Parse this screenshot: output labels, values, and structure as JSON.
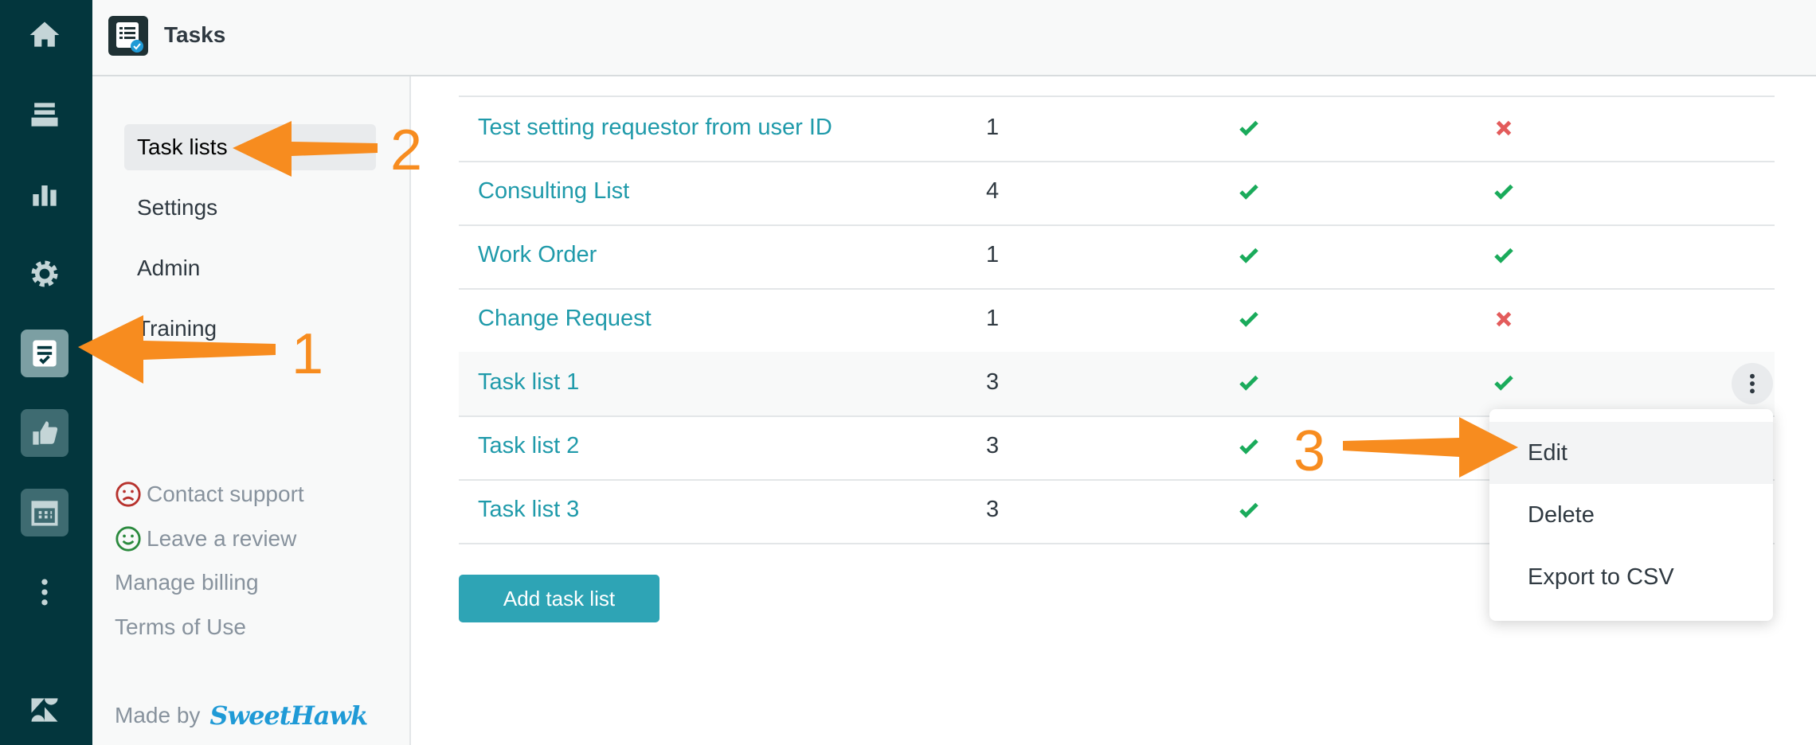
{
  "app": {
    "title": "Tasks",
    "icon": "tasks-app-icon"
  },
  "rail": {
    "icons": [
      "home-icon",
      "views-icon",
      "reporting-icon",
      "admin-gear-icon",
      "tasks-icon",
      "thumbs-up-icon",
      "calendar-icon",
      "more-vertical-icon",
      "zendesk-logo-icon"
    ]
  },
  "leftnav": {
    "items": [
      {
        "label": "Task lists",
        "active": true
      },
      {
        "label": "Settings",
        "active": false
      },
      {
        "label": "Admin",
        "active": false
      },
      {
        "label": "Training",
        "active": false
      }
    ],
    "links": [
      {
        "label": "Contact support",
        "icon": "sad-face-icon"
      },
      {
        "label": "Leave a review",
        "icon": "smiley-face-icon"
      },
      {
        "label": "Manage billing"
      },
      {
        "label": "Terms of Use"
      }
    ],
    "made_by": "Made by",
    "brand": "SweetHawk"
  },
  "table": {
    "rows": [
      {
        "name": "Test setting requestor from user ID",
        "count": "1",
        "col3": "check",
        "col4": "cross"
      },
      {
        "name": "Consulting List",
        "count": "4",
        "col3": "check",
        "col4": "check"
      },
      {
        "name": "Work Order",
        "count": "1",
        "col3": "check",
        "col4": "check"
      },
      {
        "name": "Change Request",
        "count": "1",
        "col3": "check",
        "col4": "cross"
      },
      {
        "name": "Task list 1",
        "count": "3",
        "col3": "check",
        "col4": "check"
      },
      {
        "name": "Task list 2",
        "count": "3",
        "col3": "check",
        "col4": ""
      },
      {
        "name": "Task list 3",
        "count": "3",
        "col3": "check",
        "col4": ""
      }
    ]
  },
  "add_button": "Add task list",
  "context_menu": {
    "items": [
      "Edit",
      "Delete",
      "Export to CSV"
    ]
  },
  "annotations": {
    "step1": "1",
    "step2": "2",
    "step3": "3"
  },
  "colors": {
    "rail": "#03363d",
    "link": "#1f9aaa",
    "check": "#1aab5b",
    "cross": "#e35b5b",
    "button": "#2ea4b5",
    "arrow": "#f78c1f"
  }
}
